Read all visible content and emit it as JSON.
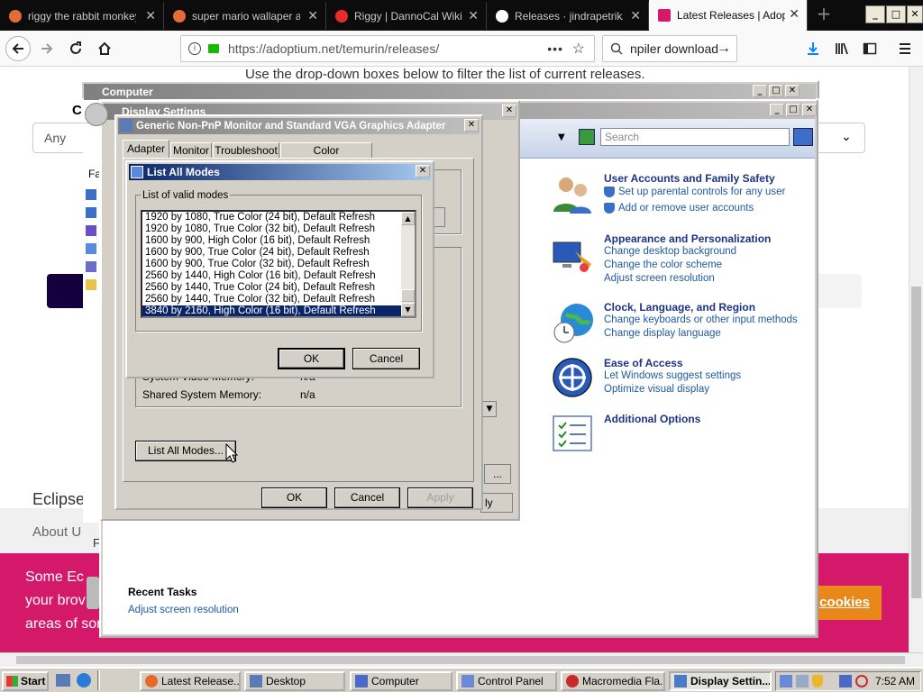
{
  "browser": {
    "tabs": [
      {
        "title": "riggy the rabbit monkey",
        "favicon_color": "#e46d35"
      },
      {
        "title": "super mario wallaper at",
        "favicon_color": "#e46d35"
      },
      {
        "title": "Riggy | DannoCal Wiki |",
        "favicon_color": "#e52d2d"
      },
      {
        "title": "Releases · jindrapetrik/",
        "favicon_color": "#ffffff"
      },
      {
        "title": "Latest Releases | Adoptium",
        "favicon_color": "#d4196a"
      }
    ],
    "url": "https://adoptium.net/temurin/releases/",
    "search_value": "npiler download",
    "window_buttons": {
      "minimize": "_",
      "maximize": "□",
      "close": "✕"
    }
  },
  "webpage": {
    "instruction_text": "Use the drop-down boxes below to filter the list of current releases.",
    "left_fragment_c": "C",
    "any_label": "Any",
    "eclipse_text": "Eclipse",
    "about_text": "About U",
    "f_text": "F",
    "cookie_text_1": "Some Ec",
    "cookie_text_2": "your brov",
    "cookie_text_3": "areas of sor",
    "cookie_button": "cookies"
  },
  "computer_window": {
    "title": "Computer",
    "fav_label": "Fa"
  },
  "display_settings": {
    "title": "Display Settings",
    "apply_label": "ly",
    "dots_label": "..."
  },
  "control_panel": {
    "search_placeholder": "Search",
    "categories": [
      {
        "heading": "User Accounts and Family Safety",
        "links": [
          "Set up parental controls for any user",
          "Add or remove user accounts"
        ]
      },
      {
        "heading": "Appearance and Personalization",
        "links": [
          "Change desktop background",
          "Change the color scheme",
          "Adjust screen resolution"
        ]
      },
      {
        "heading": "Clock, Language, and Region",
        "links": [
          "Change keyboards or other input methods",
          "Change display language"
        ]
      },
      {
        "heading": "Ease of Access",
        "links": [
          "Let Windows suggest settings",
          "Optimize visual display"
        ]
      },
      {
        "heading": "Additional Options",
        "links": []
      }
    ],
    "recent_tasks_heading": "Recent Tasks",
    "recent_tasks": [
      "Adjust screen resolution"
    ]
  },
  "adapter_dialog": {
    "title": "Generic Non-PnP Monitor and Standard VGA Graphics Adapter",
    "tabs": [
      "Adapter",
      "Monitor",
      "Troubleshoot",
      "Color Management"
    ],
    "active_tab": "Adapter",
    "system_video_memory_label": "System Video Memory:",
    "system_video_memory_value": "n/a",
    "shared_memory_label": "Shared System Memory:",
    "shared_memory_value": "n/a",
    "list_all_modes_button": "List All Modes...",
    "ok_button": "OK",
    "cancel_button": "Cancel",
    "apply_button": "Apply"
  },
  "list_modes_dialog": {
    "title": "List All Modes",
    "group_label": "List of valid modes",
    "modes": [
      "1920 by 1080, True Color (24 bit), Default Refresh",
      "1920 by 1080, True Color (32 bit), Default Refresh",
      "1600 by 900, High Color (16 bit), Default Refresh",
      "1600 by 900, True Color (24 bit), Default Refresh",
      "1600 by 900, True Color (32 bit), Default Refresh",
      "2560 by 1440, High Color (16 bit), Default Refresh",
      "2560 by 1440, True Color (24 bit), Default Refresh",
      "2560 by 1440, True Color (32 bit), Default Refresh",
      "3840 by 2160, High Color (16 bit), Default Refresh"
    ],
    "selected_index": 8,
    "ok_button": "OK",
    "cancel_button": "Cancel"
  },
  "taskbar": {
    "start_label": "Start",
    "tasks": [
      {
        "label": "Latest Release...",
        "icon": "firefox-icon"
      },
      {
        "label": "Desktop",
        "icon": "folder-icon"
      },
      {
        "label": "Computer",
        "icon": "computer-icon"
      },
      {
        "label": "Control Panel",
        "icon": "control-panel-icon"
      },
      {
        "label": "Macromedia Fla...",
        "icon": "flash-icon"
      },
      {
        "label": "Display Settin...",
        "icon": "display-icon"
      }
    ],
    "active_task": "Display Settin...",
    "clock": "7:52 AM"
  }
}
